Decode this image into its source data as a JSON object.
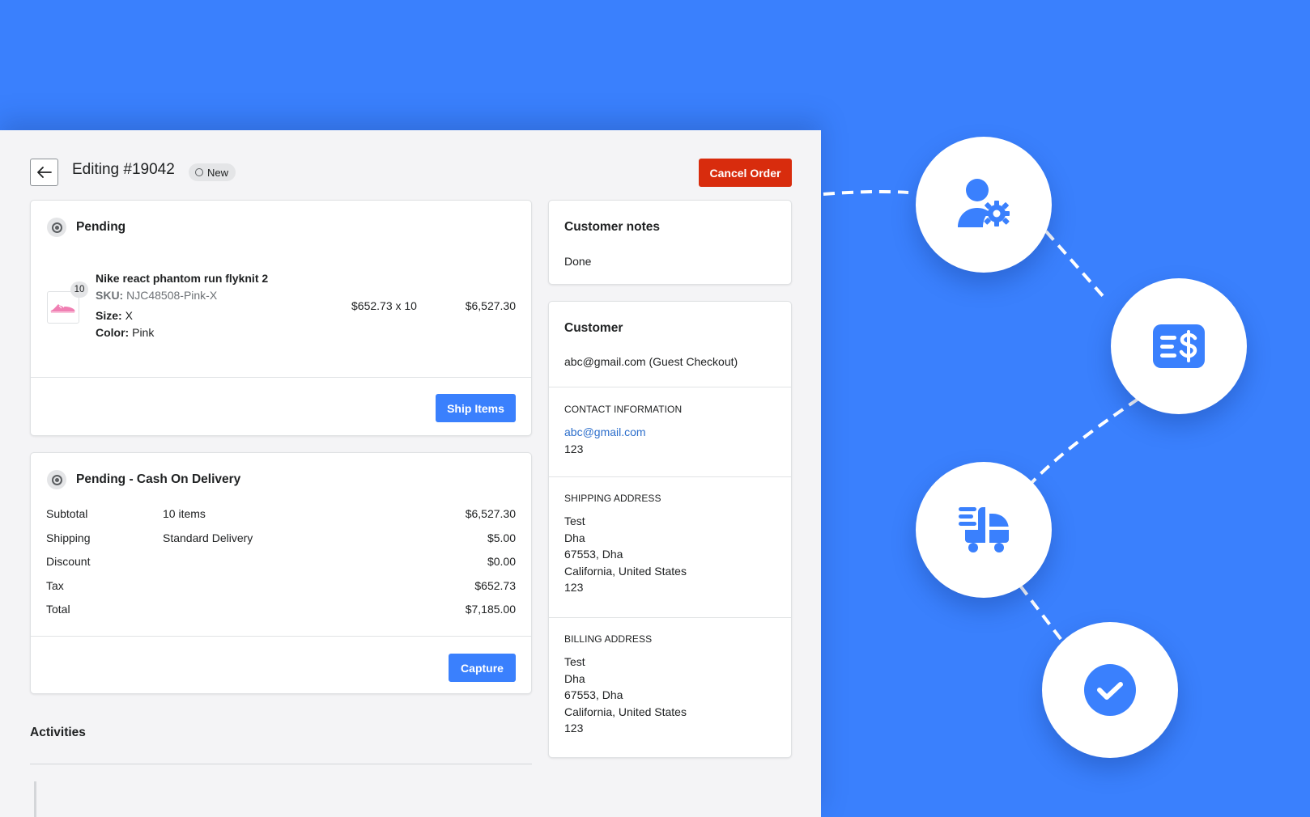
{
  "header": {
    "title": "Editing #19042",
    "status": "New",
    "cancel_label": "Cancel Order"
  },
  "fulfillment": {
    "title": "Pending",
    "item": {
      "name": "Nike react phantom run flyknit 2",
      "sku_label": "SKU:",
      "sku": "NJC48508-Pink-X",
      "size_label": "Size:",
      "size": "X",
      "color_label": "Color:",
      "color": "Pink",
      "quantity": "10",
      "unit_price": "$652.73 x 10",
      "line_total": "$6,527.30"
    },
    "ship_label": "Ship Items"
  },
  "payment": {
    "title": "Pending - Cash On Delivery",
    "rows": [
      {
        "label": "Subtotal",
        "detail": "10 items",
        "amount": "$6,527.30"
      },
      {
        "label": "Shipping",
        "detail": "Standard Delivery",
        "amount": "$5.00"
      },
      {
        "label": "Discount",
        "detail": "",
        "amount": "$0.00"
      },
      {
        "label": "Tax",
        "detail": "",
        "amount": "$652.73"
      },
      {
        "label": "Total",
        "detail": "",
        "amount": "$7,185.00"
      }
    ],
    "capture_label": "Capture"
  },
  "activities": {
    "title": "Activities"
  },
  "customer_notes": {
    "title": "Customer notes",
    "note": "Done"
  },
  "customer": {
    "title": "Customer",
    "summary": "abc@gmail.com (Guest Checkout)",
    "contact": {
      "heading": "CONTACT INFORMATION",
      "email": "abc@gmail.com",
      "phone": "123"
    },
    "shipping": {
      "heading": "SHIPPING ADDRESS",
      "lines": [
        "Test",
        "Dha",
        "67553, Dha",
        "California, United States",
        "123"
      ]
    },
    "billing": {
      "heading": "BILLING ADDRESS",
      "lines": [
        "Test",
        "Dha",
        "67553, Dha",
        "California, United States",
        "123"
      ]
    }
  },
  "flow_icons": [
    "user-gear-icon",
    "invoice-dollar-icon",
    "fast-delivery-icon",
    "check-circle-icon"
  ],
  "colors": {
    "background": "#3a80fd",
    "primary": "#3a80fd",
    "danger": "#d82c0d",
    "link": "#2c6ecb"
  }
}
